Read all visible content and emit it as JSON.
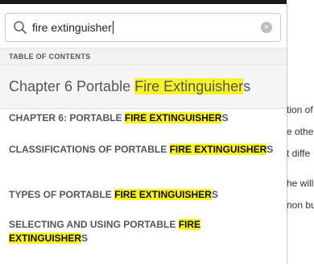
{
  "search": {
    "value": "fire extinguisher"
  },
  "toc": {
    "header": "TABLE OF CONTENTS",
    "chapter": {
      "pre": "Chapter 6 Portable ",
      "hl": "Fire Extinguisher",
      "post": "s"
    },
    "items": [
      {
        "pre": "CHAPTER 6: PORTABLE ",
        "hl": "FIRE EXTINGUISHER",
        "post": "S"
      },
      {
        "pre": "CLASSIFICATIONS OF PORTABLE ",
        "hl": "FIRE EXTINGUISHER",
        "post": "S"
      },
      {
        "pre": "TYPES OF PORTABLE ",
        "hl": "FIRE EXTINGUISHER",
        "post": "S"
      },
      {
        "pre": "SELECTING AND USING PORTABLE ",
        "hl": "FIRE EXTINGUISHER",
        "post": "S"
      }
    ]
  },
  "background_text": [
    "tion of",
    "e othe",
    "t diffe",
    "he will",
    "non bu"
  ],
  "colors": {
    "highlight": "#f8f329"
  }
}
